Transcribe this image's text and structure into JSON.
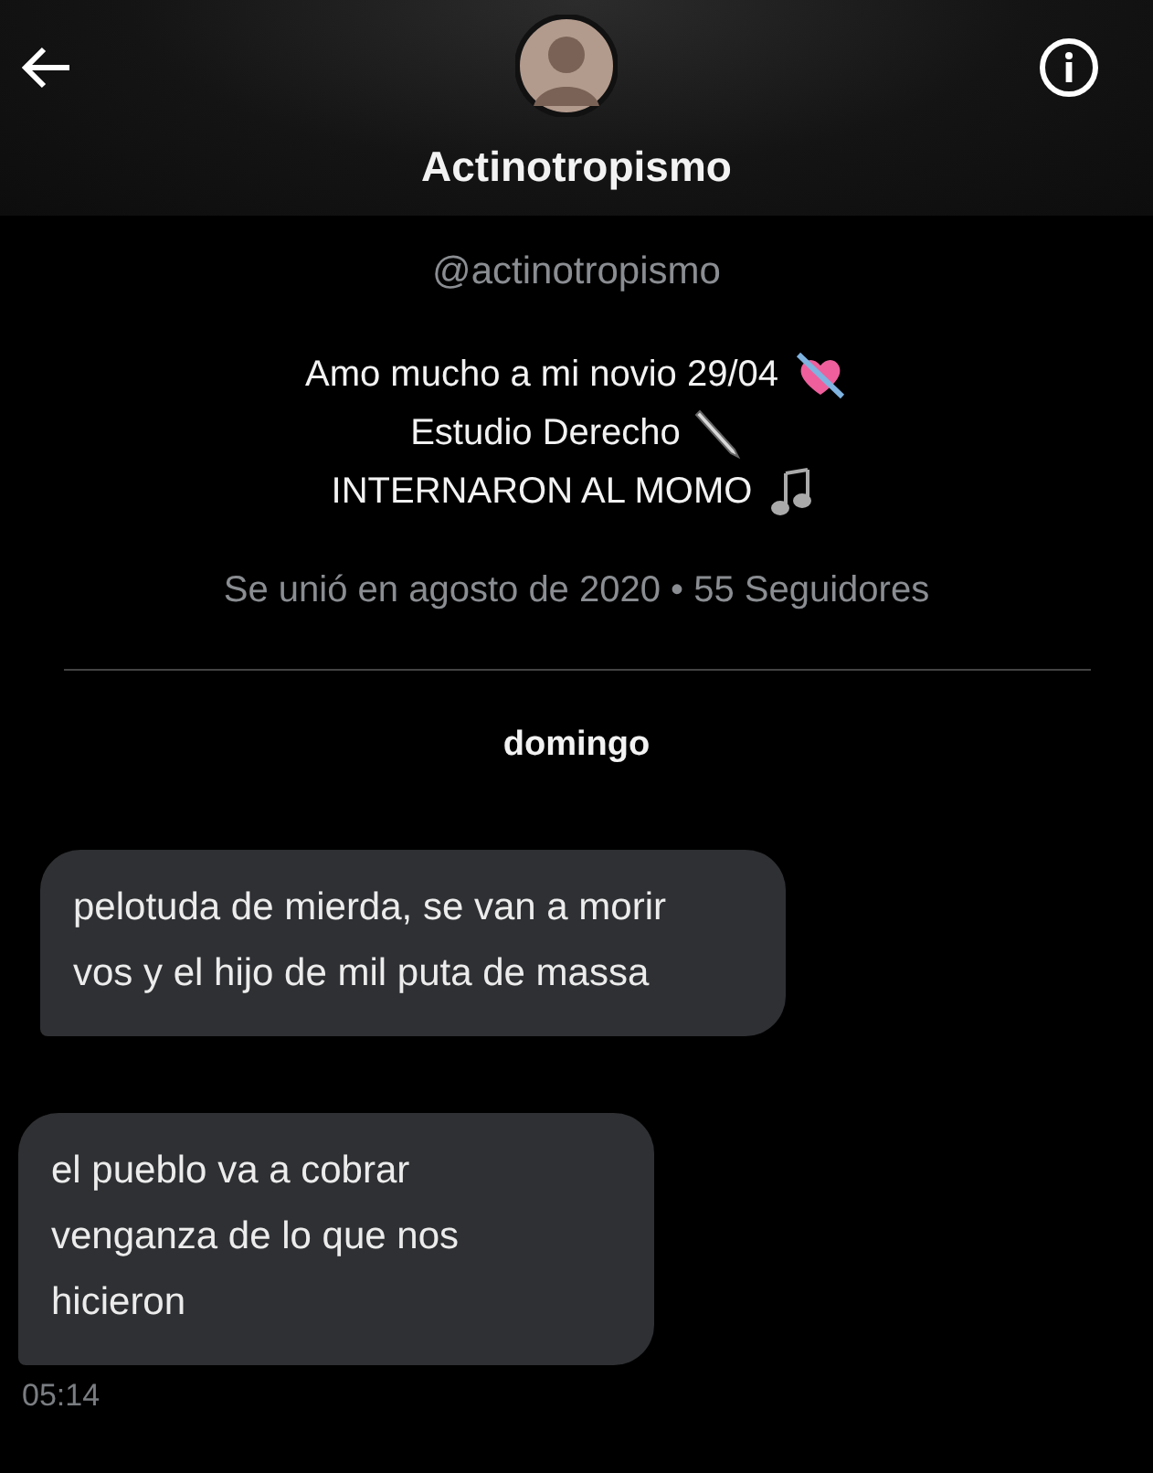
{
  "header": {
    "title": "Actinotropismo"
  },
  "profile": {
    "handle": "@actinotropismo",
    "bio": [
      {
        "text": "Amo mucho a mi novio 29/04",
        "kind": "heart"
      },
      {
        "text": "Estudio Derecho",
        "kind": "pen"
      },
      {
        "text": "INTERNARON AL MOMO",
        "kind": "notes"
      }
    ],
    "meta": "Se unió en agosto de 2020 • 55 Seguidores"
  },
  "day": "domingo",
  "messages": [
    {
      "text": "pelotuda de mierda, se van a morir vos y el hijo de mil puta de massa"
    },
    {
      "text": "el pueblo va a cobrar venganza de lo que nos hicieron"
    }
  ],
  "time": "05:14"
}
